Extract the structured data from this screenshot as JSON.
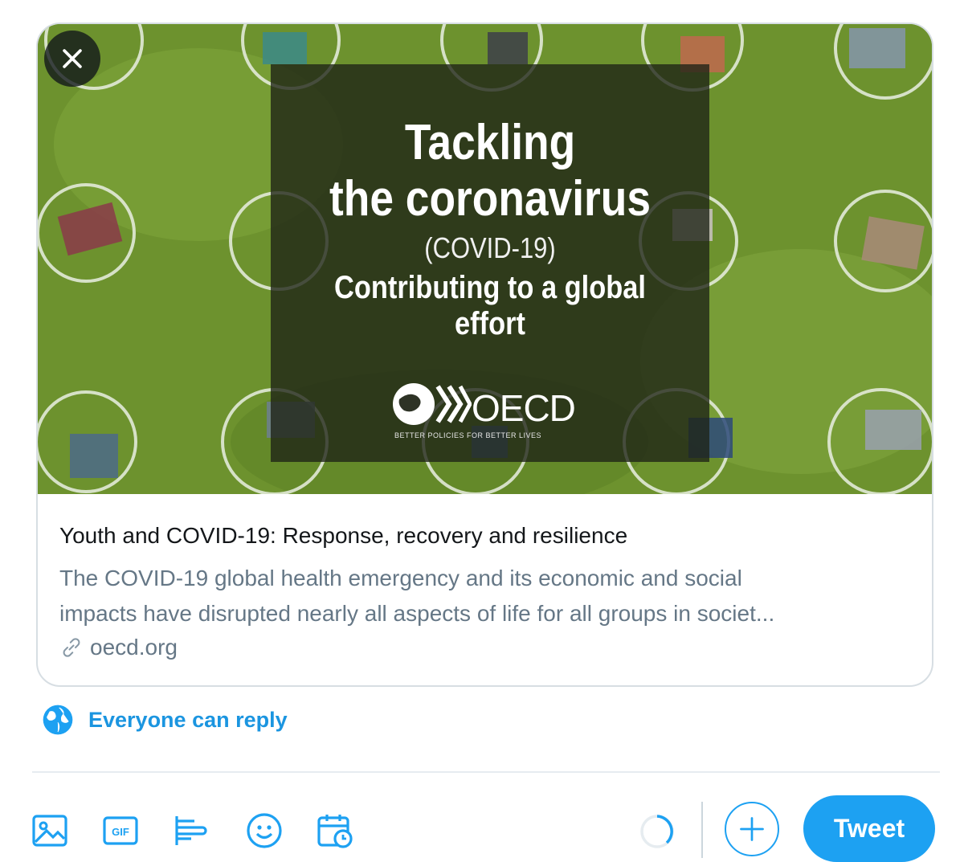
{
  "media": {
    "headline_line1": "Tackling",
    "headline_line2": "the coronavirus",
    "headline_sub": "(COVID-19)",
    "headline_tagline": "Contributing to a global effort",
    "logo_name": "OECD",
    "logo_tagline": "BETTER POLICIES FOR BETTER LIVES"
  },
  "card": {
    "title": "Youth and COVID-19: Response, recovery and resilience",
    "description_line1": "The COVID-19 global health emergency and its economic and social",
    "description_line2": "impacts have disrupted nearly all aspects of life for all groups in societ...",
    "domain": "oecd.org"
  },
  "reply": {
    "label": "Everyone can reply"
  },
  "toolbar": {
    "icons": [
      "image-icon",
      "gif-icon",
      "poll-icon",
      "emoji-icon",
      "schedule-icon"
    ],
    "tweet_label": "Tweet"
  },
  "colors": {
    "accent": "#1da1f2",
    "reply_text": "#1b95e0",
    "secondary_text": "#657786",
    "primary_text": "#14171a"
  }
}
